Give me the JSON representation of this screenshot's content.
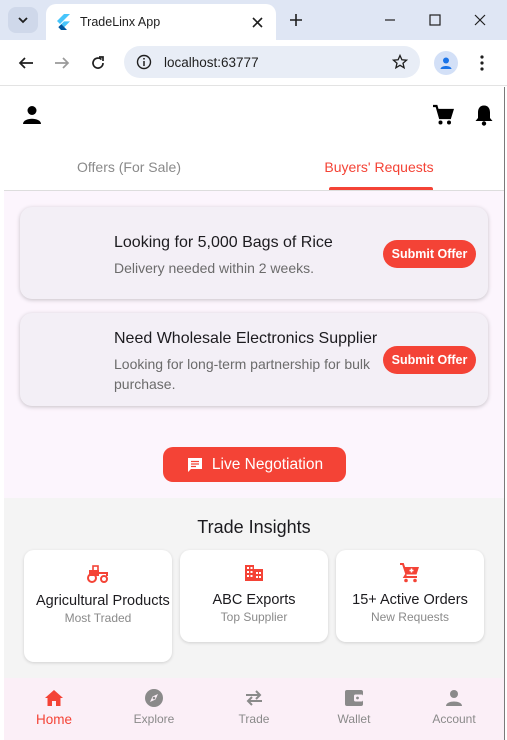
{
  "browser": {
    "tab_title": "TradeLinx App",
    "url": "localhost:63777"
  },
  "app": {
    "tabs": [
      "Offers (For Sale)",
      "Buyers' Requests"
    ],
    "requests": [
      {
        "title": "Looking for 5,000 Bags of Rice",
        "subtitle": "Delivery needed within 2 weeks.",
        "button": "Submit Offer"
      },
      {
        "title": "Need Wholesale Electronics Supplier",
        "subtitle": "Looking for long-term partnership for bulk purchase.",
        "button": "Submit Offer"
      }
    ],
    "live_negotiation": "Live Negotiation",
    "insights": {
      "title": "Trade Insights",
      "cards": [
        {
          "icon": "tractor-icon",
          "value": "Agricultural Products",
          "label": "Most Traded"
        },
        {
          "icon": "building-icon",
          "value": "ABC Exports",
          "label": "Top Supplier"
        },
        {
          "icon": "cart-icon",
          "value": "15+ Active Orders",
          "label": "New Requests"
        }
      ]
    },
    "nav": [
      {
        "icon": "home-icon",
        "label": "Home"
      },
      {
        "icon": "compass-icon",
        "label": "Explore"
      },
      {
        "icon": "swap-icon",
        "label": "Trade"
      },
      {
        "icon": "wallet-icon",
        "label": "Wallet"
      },
      {
        "icon": "person-icon",
        "label": "Account"
      }
    ],
    "colors": {
      "accent": "#f44336",
      "background": "#fcf5fd",
      "card": "#f3eff6"
    }
  }
}
